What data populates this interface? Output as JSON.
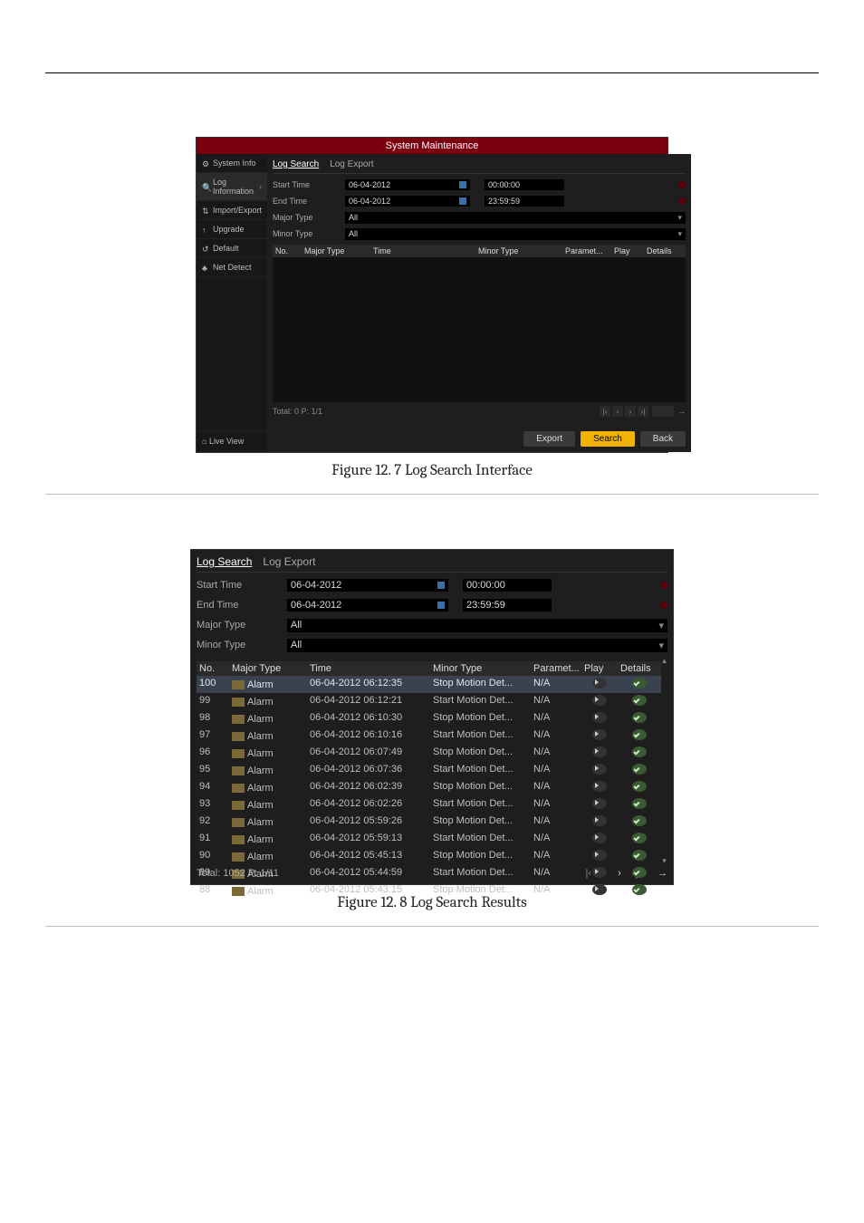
{
  "fig7": {
    "window_title": "System Maintenance",
    "sidebar": {
      "items": [
        {
          "icon": "gear-icon",
          "label": "System Info"
        },
        {
          "icon": "search-icon",
          "label": "Log Information",
          "chev": "›",
          "active": true
        },
        {
          "icon": "swap-icon",
          "label": "Import/Export"
        },
        {
          "icon": "up-icon",
          "label": "Upgrade"
        },
        {
          "icon": "reset-icon",
          "label": "Default"
        },
        {
          "icon": "net-icon",
          "label": "Net Detect"
        }
      ],
      "live": "Live View"
    },
    "tabs": {
      "search": "Log Search",
      "export": "Log Export"
    },
    "filters": {
      "start_label": "Start Time",
      "start_date": "06-04-2012",
      "start_time": "00:00:00",
      "end_label": "End Time",
      "end_date": "06-04-2012",
      "end_time": "23:59:59",
      "major_label": "Major Type",
      "major_val": "All",
      "minor_label": "Minor Type",
      "minor_val": "All"
    },
    "columns": {
      "no": "No.",
      "major": "Major Type",
      "time": "Time",
      "minor": "Minor Type",
      "param": "Paramet...",
      "play": "Play",
      "details": "Details"
    },
    "pager": {
      "total": "Total: 0  P: 1/1"
    },
    "actions": {
      "export": "Export",
      "search": "Search",
      "back": "Back"
    },
    "caption": "Figure 12. 7  Log Search Interface"
  },
  "fig8": {
    "tabs": {
      "search": "Log Search",
      "export": "Log Export"
    },
    "filters": {
      "start_label": "Start Time",
      "start_date": "06-04-2012",
      "start_time": "00:00:00",
      "end_label": "End Time",
      "end_date": "06-04-2012",
      "end_time": "23:59:59",
      "major_label": "Major Type",
      "major_val": "All",
      "minor_label": "Minor Type",
      "minor_val": "All"
    },
    "columns": {
      "no": "No.",
      "major": "Major Type",
      "time": "Time",
      "minor": "Minor Type",
      "param": "Paramet...",
      "play": "Play",
      "details": "Details"
    },
    "rows": [
      {
        "no": "100",
        "major": "Alarm",
        "time": "06-04-2012 06:12:35",
        "minor": "Stop Motion Det...",
        "param": "N/A",
        "sel": true
      },
      {
        "no": "99",
        "major": "Alarm",
        "time": "06-04-2012 06:12:21",
        "minor": "Start Motion Det...",
        "param": "N/A"
      },
      {
        "no": "98",
        "major": "Alarm",
        "time": "06-04-2012 06:10:30",
        "minor": "Stop Motion Det...",
        "param": "N/A"
      },
      {
        "no": "97",
        "major": "Alarm",
        "time": "06-04-2012 06:10:16",
        "minor": "Start Motion Det...",
        "param": "N/A"
      },
      {
        "no": "96",
        "major": "Alarm",
        "time": "06-04-2012 06:07:49",
        "minor": "Stop Motion Det...",
        "param": "N/A"
      },
      {
        "no": "95",
        "major": "Alarm",
        "time": "06-04-2012 06:07:36",
        "minor": "Start Motion Det...",
        "param": "N/A"
      },
      {
        "no": "94",
        "major": "Alarm",
        "time": "06-04-2012 06:02:39",
        "minor": "Stop Motion Det...",
        "param": "N/A"
      },
      {
        "no": "93",
        "major": "Alarm",
        "time": "06-04-2012 06:02:26",
        "minor": "Start Motion Det...",
        "param": "N/A"
      },
      {
        "no": "92",
        "major": "Alarm",
        "time": "06-04-2012 05:59:26",
        "minor": "Stop Motion Det...",
        "param": "N/A"
      },
      {
        "no": "91",
        "major": "Alarm",
        "time": "06-04-2012 05:59:13",
        "minor": "Start Motion Det...",
        "param": "N/A"
      },
      {
        "no": "90",
        "major": "Alarm",
        "time": "06-04-2012 05:45:13",
        "minor": "Stop Motion Det...",
        "param": "N/A"
      },
      {
        "no": "89",
        "major": "Alarm",
        "time": "06-04-2012 05:44:59",
        "minor": "Start Motion Det...",
        "param": "N/A"
      },
      {
        "no": "88",
        "major": "Alarm",
        "time": "06-04-2012 05:43:15",
        "minor": "Stop Motion Det...",
        "param": "N/A"
      }
    ],
    "pager": {
      "total": "Total: 1052  P: 1/11"
    },
    "caption": "Figure 12. 8  Log Search Results"
  }
}
